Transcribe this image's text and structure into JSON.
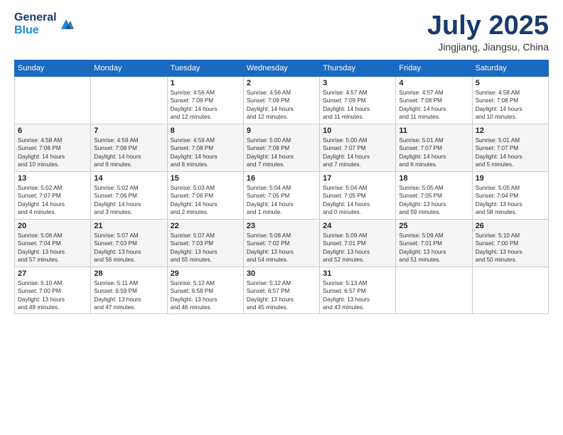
{
  "header": {
    "logo_general": "General",
    "logo_blue": "Blue",
    "month_title": "July 2025",
    "location": "Jingjiang, Jiangsu, China"
  },
  "calendar": {
    "days_of_week": [
      "Sunday",
      "Monday",
      "Tuesday",
      "Wednesday",
      "Thursday",
      "Friday",
      "Saturday"
    ],
    "weeks": [
      [
        {
          "day": "",
          "info": ""
        },
        {
          "day": "",
          "info": ""
        },
        {
          "day": "1",
          "info": "Sunrise: 4:56 AM\nSunset: 7:09 PM\nDaylight: 14 hours\nand 12 minutes."
        },
        {
          "day": "2",
          "info": "Sunrise: 4:56 AM\nSunset: 7:09 PM\nDaylight: 14 hours\nand 12 minutes."
        },
        {
          "day": "3",
          "info": "Sunrise: 4:57 AM\nSunset: 7:09 PM\nDaylight: 14 hours\nand 11 minutes."
        },
        {
          "day": "4",
          "info": "Sunrise: 4:57 AM\nSunset: 7:08 PM\nDaylight: 14 hours\nand 11 minutes."
        },
        {
          "day": "5",
          "info": "Sunrise: 4:58 AM\nSunset: 7:08 PM\nDaylight: 14 hours\nand 10 minutes."
        }
      ],
      [
        {
          "day": "6",
          "info": "Sunrise: 4:58 AM\nSunset: 7:08 PM\nDaylight: 14 hours\nand 10 minutes."
        },
        {
          "day": "7",
          "info": "Sunrise: 4:59 AM\nSunset: 7:08 PM\nDaylight: 14 hours\nand 9 minutes."
        },
        {
          "day": "8",
          "info": "Sunrise: 4:59 AM\nSunset: 7:08 PM\nDaylight: 14 hours\nand 8 minutes."
        },
        {
          "day": "9",
          "info": "Sunrise: 5:00 AM\nSunset: 7:08 PM\nDaylight: 14 hours\nand 7 minutes."
        },
        {
          "day": "10",
          "info": "Sunrise: 5:00 AM\nSunset: 7:07 PM\nDaylight: 14 hours\nand 7 minutes."
        },
        {
          "day": "11",
          "info": "Sunrise: 5:01 AM\nSunset: 7:07 PM\nDaylight: 14 hours\nand 6 minutes."
        },
        {
          "day": "12",
          "info": "Sunrise: 5:01 AM\nSunset: 7:07 PM\nDaylight: 14 hours\nand 5 minutes."
        }
      ],
      [
        {
          "day": "13",
          "info": "Sunrise: 5:02 AM\nSunset: 7:07 PM\nDaylight: 14 hours\nand 4 minutes."
        },
        {
          "day": "14",
          "info": "Sunrise: 5:02 AM\nSunset: 7:06 PM\nDaylight: 14 hours\nand 3 minutes."
        },
        {
          "day": "15",
          "info": "Sunrise: 5:03 AM\nSunset: 7:06 PM\nDaylight: 14 hours\nand 2 minutes."
        },
        {
          "day": "16",
          "info": "Sunrise: 5:04 AM\nSunset: 7:05 PM\nDaylight: 14 hours\nand 1 minute."
        },
        {
          "day": "17",
          "info": "Sunrise: 5:04 AM\nSunset: 7:05 PM\nDaylight: 14 hours\nand 0 minutes."
        },
        {
          "day": "18",
          "info": "Sunrise: 5:05 AM\nSunset: 7:05 PM\nDaylight: 13 hours\nand 59 minutes."
        },
        {
          "day": "19",
          "info": "Sunrise: 5:05 AM\nSunset: 7:04 PM\nDaylight: 13 hours\nand 58 minutes."
        }
      ],
      [
        {
          "day": "20",
          "info": "Sunrise: 5:06 AM\nSunset: 7:04 PM\nDaylight: 13 hours\nand 57 minutes."
        },
        {
          "day": "21",
          "info": "Sunrise: 5:07 AM\nSunset: 7:03 PM\nDaylight: 13 hours\nand 56 minutes."
        },
        {
          "day": "22",
          "info": "Sunrise: 5:07 AM\nSunset: 7:03 PM\nDaylight: 13 hours\nand 55 minutes."
        },
        {
          "day": "23",
          "info": "Sunrise: 5:08 AM\nSunset: 7:02 PM\nDaylight: 13 hours\nand 54 minutes."
        },
        {
          "day": "24",
          "info": "Sunrise: 5:09 AM\nSunset: 7:01 PM\nDaylight: 13 hours\nand 52 minutes."
        },
        {
          "day": "25",
          "info": "Sunrise: 5:09 AM\nSunset: 7:01 PM\nDaylight: 13 hours\nand 51 minutes."
        },
        {
          "day": "26",
          "info": "Sunrise: 5:10 AM\nSunset: 7:00 PM\nDaylight: 13 hours\nand 50 minutes."
        }
      ],
      [
        {
          "day": "27",
          "info": "Sunrise: 5:10 AM\nSunset: 7:00 PM\nDaylight: 13 hours\nand 49 minutes."
        },
        {
          "day": "28",
          "info": "Sunrise: 5:11 AM\nSunset: 6:59 PM\nDaylight: 13 hours\nand 47 minutes."
        },
        {
          "day": "29",
          "info": "Sunrise: 5:12 AM\nSunset: 6:58 PM\nDaylight: 13 hours\nand 46 minutes."
        },
        {
          "day": "30",
          "info": "Sunrise: 5:12 AM\nSunset: 6:57 PM\nDaylight: 13 hours\nand 45 minutes."
        },
        {
          "day": "31",
          "info": "Sunrise: 5:13 AM\nSunset: 6:57 PM\nDaylight: 13 hours\nand 43 minutes."
        },
        {
          "day": "",
          "info": ""
        },
        {
          "day": "",
          "info": ""
        }
      ]
    ]
  }
}
